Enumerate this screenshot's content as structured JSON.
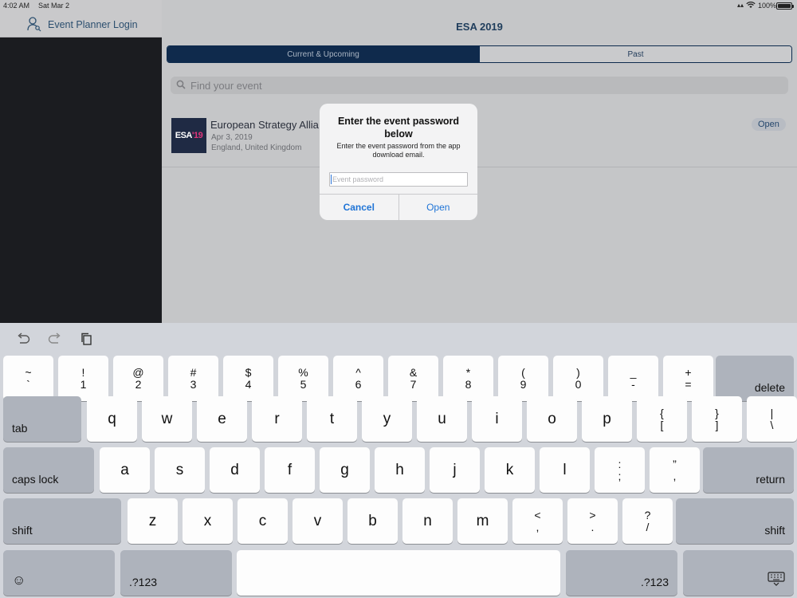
{
  "status_bar": {
    "time": "4:02 AM",
    "date": "Sat Mar 2",
    "battery": "100%",
    "signal_icon": "wifi-icon"
  },
  "sidebar": {
    "login_label": "Event Planner Login",
    "login_icon": "user-key-icon"
  },
  "main": {
    "title": "ESA 2019",
    "tabs": [
      {
        "label": "Current & Upcoming",
        "selected": true
      },
      {
        "label": "Past",
        "selected": false
      }
    ],
    "search": {
      "placeholder": "Find your event"
    },
    "event": {
      "logo_text": "ESA",
      "logo_accent": "'19",
      "name": "European Strategy Allia",
      "date": "Apr 3, 2019",
      "location": "England, United Kingdom",
      "open_label": "Open"
    }
  },
  "alert": {
    "title": "Enter the event password below",
    "message": "Enter the event password from the app download email.",
    "input_placeholder": "Event password",
    "cancel_label": "Cancel",
    "open_label": "Open"
  },
  "keyboard": {
    "toolbar": [
      "undo-icon",
      "redo-icon",
      "paste-icon"
    ],
    "row1": [
      {
        "top": "~",
        "bot": "`"
      },
      {
        "top": "!",
        "bot": "1"
      },
      {
        "top": "@",
        "bot": "2"
      },
      {
        "top": "#",
        "bot": "3"
      },
      {
        "top": "$",
        "bot": "4"
      },
      {
        "top": "%",
        "bot": "5"
      },
      {
        "top": "^",
        "bot": "6"
      },
      {
        "top": "&",
        "bot": "7"
      },
      {
        "top": "*",
        "bot": "8"
      },
      {
        "top": "(",
        "bot": "9"
      },
      {
        "top": ")",
        "bot": "0"
      },
      {
        "top": "_",
        "bot": "-"
      },
      {
        "top": "+",
        "bot": "="
      }
    ],
    "delete_label": "delete",
    "tab_label": "tab",
    "row2": [
      "q",
      "w",
      "e",
      "r",
      "t",
      "y",
      "u",
      "i",
      "o",
      "p"
    ],
    "row2_sym": [
      {
        "top": "{",
        "bot": "["
      },
      {
        "top": "}",
        "bot": "]"
      },
      {
        "top": "|",
        "bot": "\\"
      }
    ],
    "caps_label": "caps lock",
    "row3": [
      "a",
      "s",
      "d",
      "f",
      "g",
      "h",
      "j",
      "k",
      "l"
    ],
    "row3_sym": [
      {
        "top": ":",
        "bot": ";"
      },
      {
        "top": "”",
        "bot": ","
      }
    ],
    "return_label": "return",
    "shift_label": "shift",
    "row4": [
      "z",
      "x",
      "c",
      "v",
      "b",
      "n",
      "m"
    ],
    "row4_sym": [
      {
        "top": "<",
        "bot": ","
      },
      {
        "top": ">",
        "bot": "."
      },
      {
        "top": "?",
        "bot": "/"
      }
    ],
    "numbers_label": ".?123",
    "emoji_icon": "emoji-icon",
    "dismiss_icon": "keyboard-dismiss-icon"
  }
}
